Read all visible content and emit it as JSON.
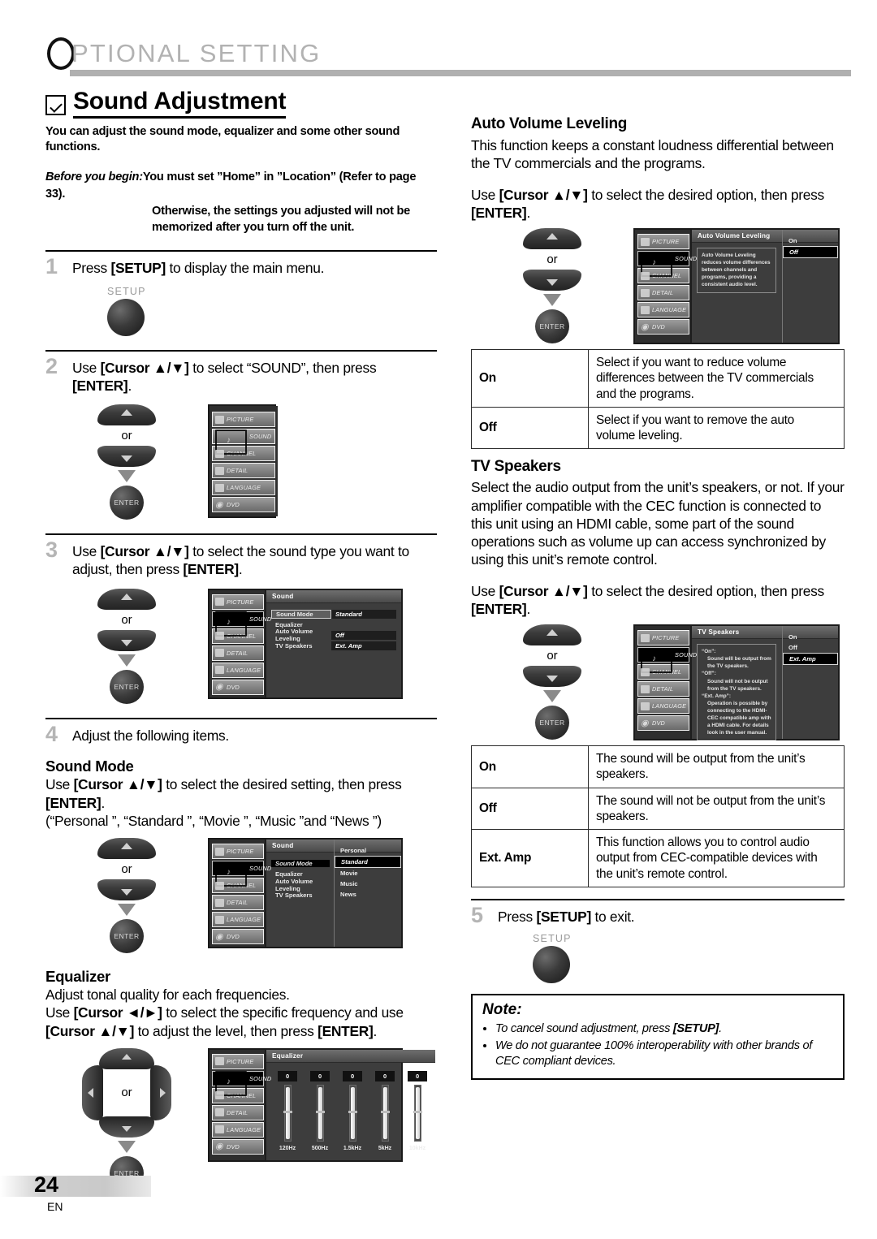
{
  "header": {
    "title_first": "O",
    "title_rest": "PTIONAL  SETTING"
  },
  "section": {
    "title": "Sound Adjustment",
    "lead": "You can adjust the sound mode, equalizer and some other sound functions.",
    "before_label": "Before you begin:",
    "before_line1": "You must set ”Home” in ”Location” (Refer to page 33).",
    "before_line2": "Otherwise, the settings you adjusted will not be",
    "before_line3": "memorized after you turn off the unit."
  },
  "steps": {
    "s1_num": "1",
    "s1_text": "Press [SETUP] to display the main menu.",
    "s2_num": "2",
    "s2_text": "Use [Cursor ▲/▼] to select “SOUND”, then press [ENTER].",
    "s3_num": "3",
    "s3_text": "Use [Cursor ▲/▼] to select the sound type you want to adjust, then press [ENTER].",
    "s4_num": "4",
    "s4_text": "Adjust the following items.",
    "s5_num": "5",
    "s5_text": "Press [SETUP] to exit."
  },
  "buttons": {
    "setup_label": "SETUP",
    "enter_label": "ENTER",
    "or_label": "or"
  },
  "sound_mode": {
    "heading": "Sound Mode",
    "line1": "Use [Cursor ▲/▼] to select the desired setting, then press [ENTER].",
    "line2": "(“Personal ”, “Standard ”, “Movie ”, “Music ”and “News ”)",
    "options": [
      "Personal",
      "Standard",
      "Movie",
      "Music",
      "News"
    ],
    "selected": "Standard"
  },
  "equalizer": {
    "heading": "Equalizer",
    "line1": "Adjust tonal quality for each frequencies.",
    "line2": "Use [Cursor ◄/►] to select the specific frequency and use [Cursor ▲/▼] to adjust the level, then press [ENTER].",
    "osd_title": "Equalizer",
    "bands": [
      {
        "freq": "120Hz",
        "value": "0"
      },
      {
        "freq": "500Hz",
        "value": "0"
      },
      {
        "freq": "1.5kHz",
        "value": "0"
      },
      {
        "freq": "5kHz",
        "value": "0"
      },
      {
        "freq": "10kHz",
        "value": "0"
      }
    ]
  },
  "auto_volume": {
    "heading": "Auto Volume Leveling",
    "para1": "This function keeps a constant loudness differential between the TV commercials and the programs.",
    "para2": "Use [Cursor ▲/▼] to select the desired option, then press [ENTER].",
    "osd_title": "Auto Volume Leveling",
    "osd_desc": "Auto Volume Leveling reduces volume differences between channels and programs, providing a consistent audio level.",
    "osd_options": [
      "On",
      "Off"
    ],
    "osd_selected": "Off",
    "table": [
      {
        "key": "On",
        "desc": "Select if you want to reduce volume differences between the TV commercials and the programs."
      },
      {
        "key": "Off",
        "desc": "Select if you want to remove the auto volume leveling."
      }
    ]
  },
  "tv_speakers": {
    "heading": "TV Speakers",
    "para1": "Select the audio output from the unit’s speakers, or not. If your amplifier compatible with the CEC function is connected to this unit using an HDMI cable, some part of the sound operations such as volume up can access synchronized by using this unit’s remote control.",
    "para2": "Use [Cursor ▲/▼] to select the desired option, then press [ENTER].",
    "osd_title": "TV Speakers",
    "osd_desc_1_key": "“On”:",
    "osd_desc_1_body": "Sound will be output from the TV speakers.",
    "osd_desc_2_key": "“Off”:",
    "osd_desc_2_body": "Sound will not be output from the TV speakers.",
    "osd_desc_3_key": "“Ext. Amp”:",
    "osd_desc_3_body": "Operation is possible by connecting to the HDMI-CEC compatible amp with a HDMI cable. For details look in the user manual.",
    "osd_options": [
      "On",
      "Off",
      "Ext. Amp"
    ],
    "osd_selected": "Ext. Amp",
    "table": [
      {
        "key": "On",
        "desc": "The sound will be output from the unit’s speakers."
      },
      {
        "key": "Off",
        "desc": "The sound will not be output from the unit’s speakers."
      },
      {
        "key": "Ext. Amp",
        "desc": "This function allows you to control audio output from CEC-compatible devices with the unit’s remote control."
      }
    ]
  },
  "sound_menu_osd": {
    "title": "Sound",
    "rows": [
      {
        "label": "Sound Mode",
        "value": "Standard"
      },
      {
        "label": "Equalizer",
        "value": ""
      },
      {
        "label": "Auto Volume Leveling",
        "value": "Off"
      },
      {
        "label": "TV Speakers",
        "value": "Ext. Amp"
      }
    ]
  },
  "main_menu_osd": {
    "items": [
      "PICTURE",
      "SOUND",
      "CHANNEL",
      "DETAIL",
      "LANGUAGE",
      "DVD"
    ],
    "selected": "SOUND"
  },
  "note": {
    "heading": "Note:",
    "items": [
      "To cancel sound adjustment, press [SETUP].",
      "We do not guarantee 100% interoperability with other brands of CEC compliant devices."
    ]
  },
  "footer": {
    "page": "24",
    "lang": "EN"
  }
}
